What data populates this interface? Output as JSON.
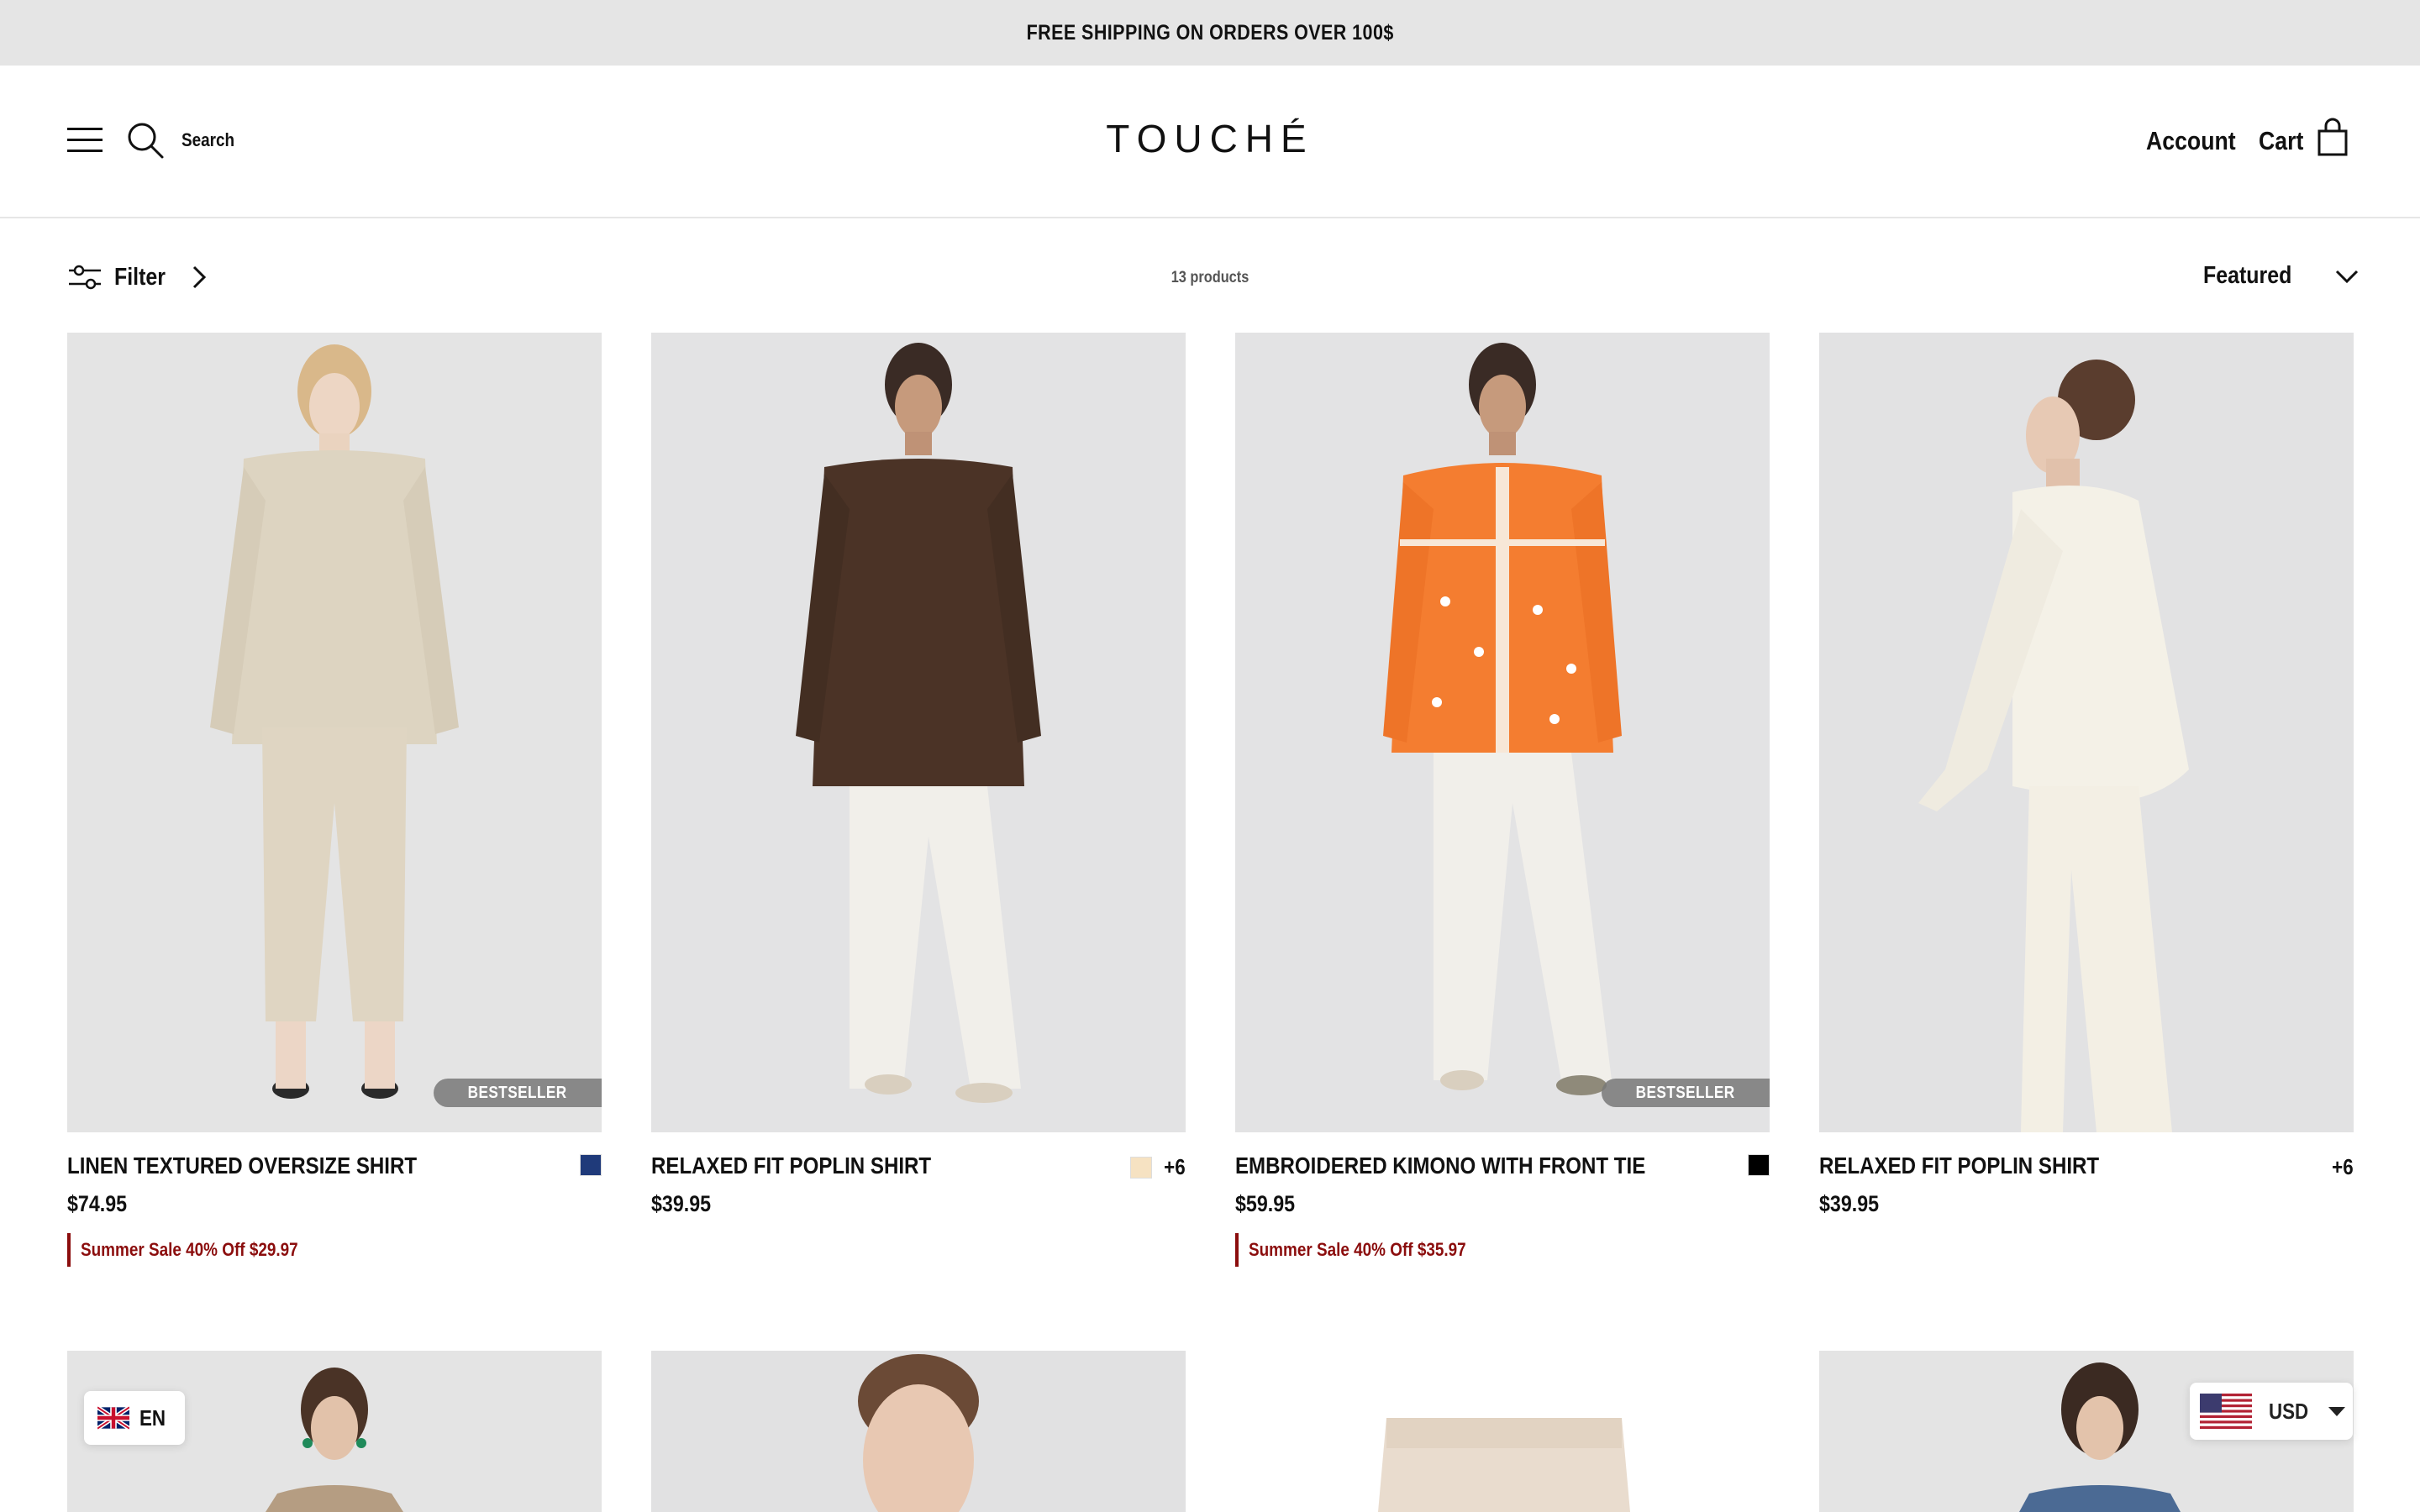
{
  "announcement": "FREE SHIPPING ON ORDERS OVER 100$",
  "header": {
    "search_label": "Search",
    "logo": "TOUCHÉ",
    "account_label": "Account",
    "cart_label": "Cart"
  },
  "toolbar": {
    "filter_label": "Filter",
    "product_count": "13 products",
    "sort_label": "Featured"
  },
  "products": [
    {
      "title": "LINEN TEXTURED OVERSIZE SHIRT",
      "price": "$74.95",
      "badge": "BESTSELLER",
      "sale_text": "Summer Sale 40% Off  $29.97",
      "swatch_color": "#1f3a7a",
      "image_icon": "model-photo"
    },
    {
      "title": "RELAXED FIT POPLIN SHIRT",
      "price": "$39.95",
      "swatch_color": "#f6e2c2",
      "more_colors": "+6",
      "image_icon": "model-photo"
    },
    {
      "title": "EMBROIDERED KIMONO WITH FRONT TIE",
      "price": "$59.95",
      "badge": "BESTSELLER",
      "sale_text": "Summer Sale 40% Off  $35.97",
      "swatch_color": "#000000",
      "image_icon": "model-photo"
    },
    {
      "title": "RELAXED FIT POPLIN SHIRT",
      "price": "$39.95",
      "more_colors": "+6",
      "image_icon": "model-photo"
    }
  ],
  "floating": {
    "language_code": "EN",
    "currency_code": "USD"
  },
  "colors": {
    "sale_red": "#8b0d0d",
    "announcement_bg": "#e5e5e5"
  }
}
